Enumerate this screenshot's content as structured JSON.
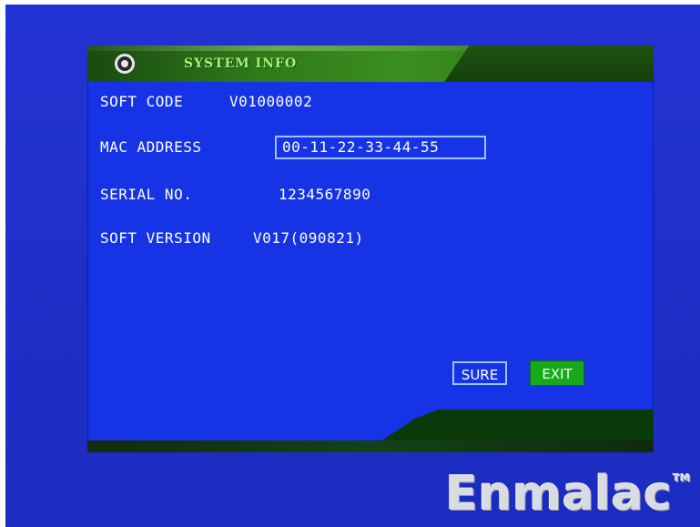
{
  "window": {
    "title": "SYSTEM INFO",
    "icon": "gear-icon"
  },
  "info": {
    "soft_code_label": "SOFT CODE",
    "soft_code_value": "V01000002",
    "mac_address_label": "MAC ADDRESS",
    "mac_address_value": "00-11-22-33-44-55",
    "serial_label": "SERIAL NO.",
    "serial_value": "1234567890",
    "soft_version_label": "SOFT VERSION",
    "soft_version_value": "V017(090821)"
  },
  "buttons": {
    "sure_label": "SURE",
    "exit_label": "EXIT"
  },
  "brand": {
    "logo_text": "Enmalac",
    "trademark": "TM"
  },
  "colors": {
    "background": "#1f30c8",
    "panel": "#1634e6",
    "title_bar": "#2f7a1a",
    "title_text": "#a4f178",
    "exit_button": "#19a81a",
    "focus_border": "#9cc4ff"
  }
}
